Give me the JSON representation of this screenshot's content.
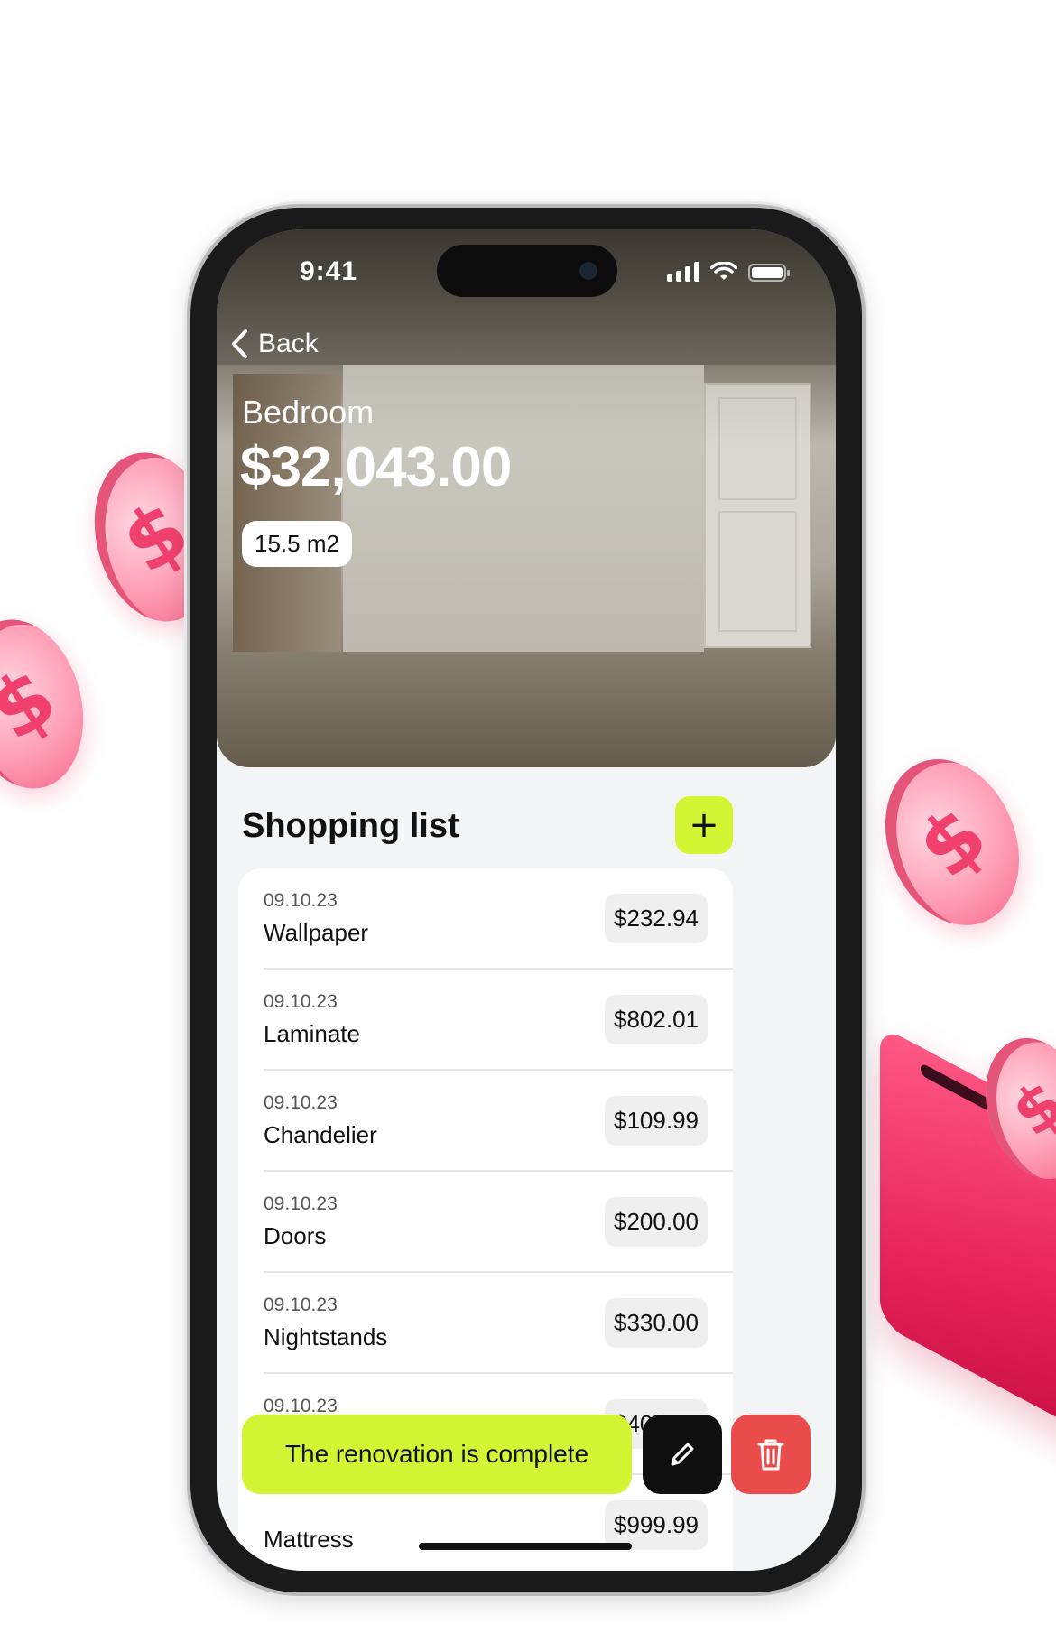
{
  "status_bar": {
    "time": "9:41"
  },
  "header": {
    "back_label": "Back",
    "room_name": "Bedroom",
    "total_cost": "$32,043.00",
    "area": "15.5 m2"
  },
  "shopping_list": {
    "title": "Shopping list",
    "add_label": "+",
    "items": [
      {
        "date": "09.10.23",
        "name": "Wallpaper",
        "price": "$232.94"
      },
      {
        "date": "09.10.23",
        "name": "Laminate",
        "price": "$802.01"
      },
      {
        "date": "09.10.23",
        "name": "Chandelier",
        "price": "$109.99"
      },
      {
        "date": "09.10.23",
        "name": "Doors",
        "price": "$200.00"
      },
      {
        "date": "09.10.23",
        "name": "Nightstands",
        "price": "$330.00"
      },
      {
        "date": "09.10.23",
        "name": "",
        "price": "$400.99"
      },
      {
        "date": "",
        "name": "Mattress",
        "price": "$999.99"
      }
    ]
  },
  "actions": {
    "complete_label": "The renovation is complete"
  },
  "decor": {
    "coin_symbol": "$"
  },
  "colors": {
    "accent_lime": "#d3f534",
    "delete_red": "#ea4b4b",
    "edit_black": "#0f0f0f",
    "coin_pink": "#ff9db6"
  },
  "icons": [
    "chevron-left-icon",
    "plus-icon",
    "pencil-icon",
    "trash-icon",
    "signal-icon",
    "wifi-icon",
    "battery-icon",
    "dollar-coin-icon",
    "wallet-icon"
  ]
}
